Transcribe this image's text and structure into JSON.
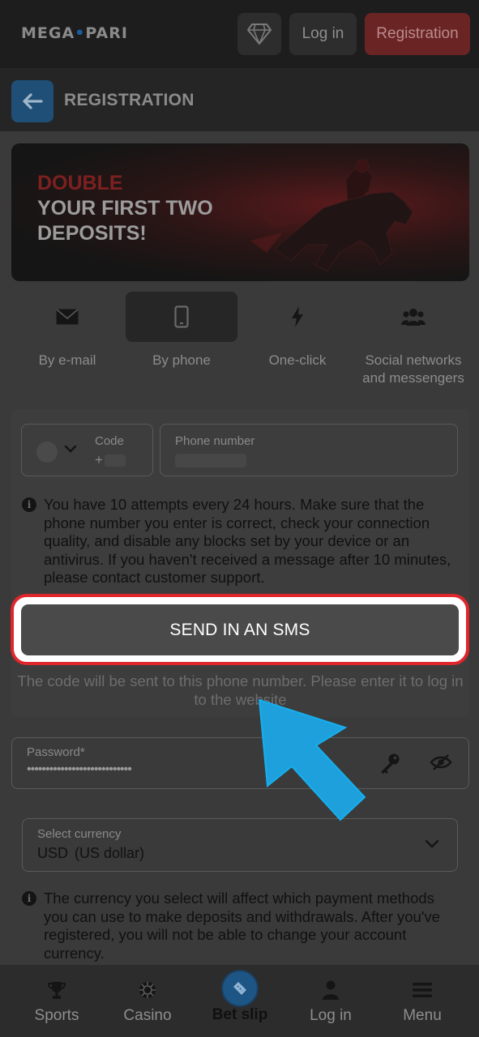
{
  "header": {
    "logo_left": "MEGA",
    "logo_dot": "•",
    "logo_right": "PARI",
    "login_label": "Log in",
    "registration_label": "Registration",
    "diamond_icon": "diamond-icon"
  },
  "page": {
    "title": "REGISTRATION",
    "back_icon": "arrow-left-icon"
  },
  "banner": {
    "line1": "DOUBLE",
    "line2": "YOUR FIRST TWO",
    "line3": "DEPOSITS!"
  },
  "tabs": [
    {
      "label": "By e-mail",
      "icon": "envelope-icon",
      "active": false
    },
    {
      "label": "By phone",
      "icon": "phone-icon",
      "active": true
    },
    {
      "label": "One-click",
      "icon": "lightning-icon",
      "active": false
    },
    {
      "label": "Social networks and messengers",
      "icon": "users-icon",
      "active": false
    }
  ],
  "form": {
    "code_label": "Code",
    "code_value": "+",
    "phone_label": "Phone number",
    "attempts_info": "You have 10 attempts every 24 hours. Make sure that the phone number you enter is correct, check your connection quality, and disable any blocks set by your device or an antivirus. If you haven't received a message after 10 minutes, please contact customer support.",
    "sms_button": "SEND IN AN SMS",
    "sms_note": "The code will be sent to this phone number. Please enter it to log in to the website",
    "password_label": "Password*",
    "password_value": "••••••••••••••••••••••••••••",
    "currency_label": "Select currency",
    "currency_code": "USD",
    "currency_name": "(US dollar)",
    "currency_info": "The currency you select will affect which payment methods you can use to make deposits and withdrawals. After you've registered, you will not be able to change your account currency."
  },
  "bottom_nav": [
    {
      "label": "Sports",
      "icon": "trophy-icon"
    },
    {
      "label": "Casino",
      "icon": "poker-chip-icon"
    },
    {
      "label": "Bet slip",
      "icon": "ticket-icon"
    },
    {
      "label": "Log in",
      "icon": "user-icon"
    },
    {
      "label": "Menu",
      "icon": "hamburger-menu-icon"
    }
  ],
  "colors": {
    "highlight_border": "#e0262d",
    "pointer_arrow": "#1ea0dc",
    "brand_blue": "#1d5585",
    "registration_red": "#6b2424"
  }
}
